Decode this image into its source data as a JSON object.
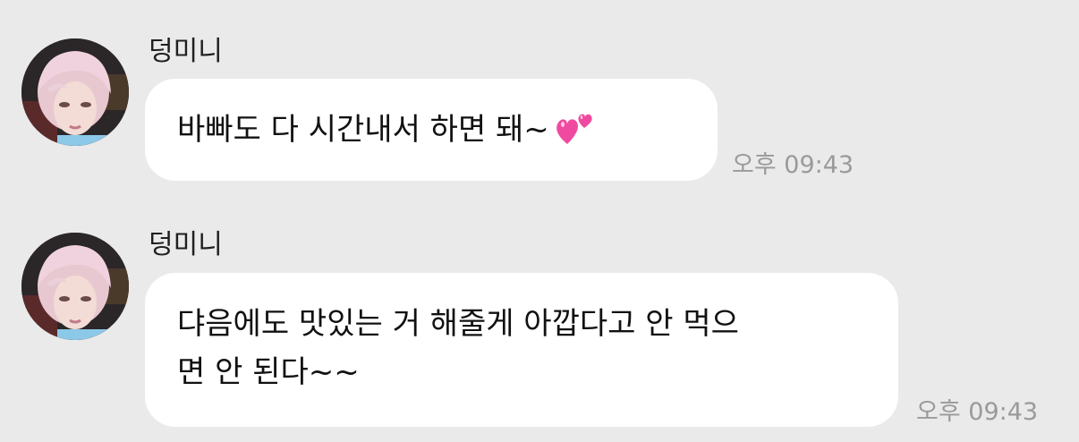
{
  "messages": [
    {
      "sender": "덩미니",
      "lines": [
        "바빠도 다 시간내서 하면 돼~"
      ],
      "emoji": "two-hearts",
      "time": "오후 09:43"
    },
    {
      "sender": "덩미니",
      "lines": [
        "댜음에도 맛있는 거 해줄게 아깝다고 안 먹으",
        "면 안 된다~~"
      ],
      "time": "오후 09:43"
    }
  ],
  "colors": {
    "background": "#eaeaea",
    "bubble": "#ffffff",
    "timestamp": "#9a9a9a",
    "heart": "#f04aa0"
  }
}
